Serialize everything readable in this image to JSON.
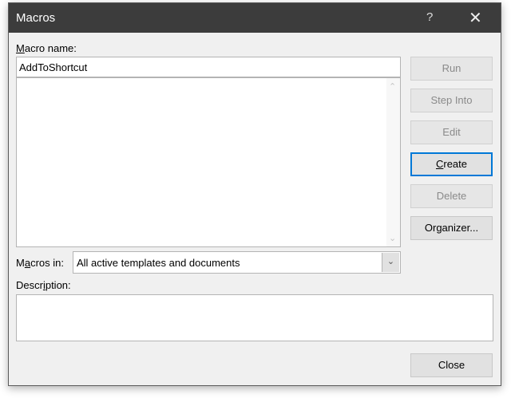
{
  "window": {
    "title": "Macros",
    "help": "?",
    "close": "✕"
  },
  "macro_name": {
    "label_accel": "M",
    "label_rest": "acro name:",
    "value": "AddToShortcut"
  },
  "macros_in": {
    "label_pre": "M",
    "label_accel": "a",
    "label_rest": "cros in:",
    "value": "All active templates and documents"
  },
  "description": {
    "label_pre": "Descr",
    "label_accel": "i",
    "label_rest": "ption:",
    "value": ""
  },
  "buttons": {
    "run": "Run",
    "step_into": "Step Into",
    "edit": "Edit",
    "create_accel": "C",
    "create_rest": "reate",
    "delete": "Delete",
    "organizer": "Organizer...",
    "close": "Close"
  },
  "icons": {
    "scroll_up": "⌃",
    "scroll_down": "⌄",
    "dropdown": "⌄"
  },
  "colors": {
    "titlebar": "#3c3c3c",
    "default_button_border": "#0078d7"
  }
}
